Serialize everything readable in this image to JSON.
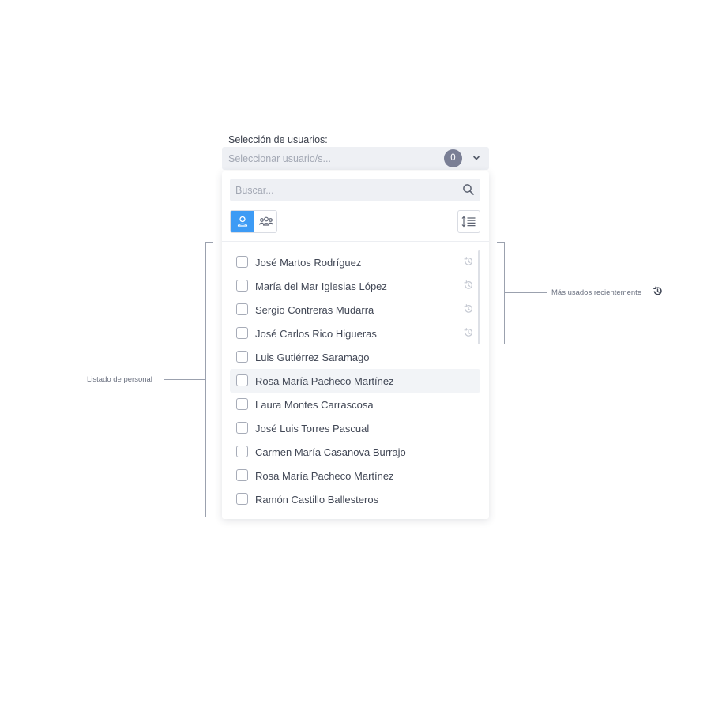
{
  "selector": {
    "label": "Selección de usuarios:",
    "placeholder": "Seleccionar usuario/s...",
    "selected_count": "0"
  },
  "dropdown": {
    "search_placeholder": "Buscar...",
    "active_tab": "users",
    "items": [
      {
        "label": "José Martos Rodríguez",
        "recent": true,
        "checked": false
      },
      {
        "label": "María del Mar Iglesias López",
        "recent": true,
        "checked": false
      },
      {
        "label": "Sergio Contreras Mudarra",
        "recent": true,
        "checked": false
      },
      {
        "label": "José Carlos Rico Higueras",
        "recent": true,
        "checked": false
      },
      {
        "label": "Luis Gutiérrez Saramago",
        "recent": false,
        "checked": false
      },
      {
        "label": "Rosa María Pacheco Martínez",
        "recent": false,
        "checked": false
      },
      {
        "label": "Laura Montes Carrascosa",
        "recent": false,
        "checked": false
      },
      {
        "label": "José Luis Torres Pascual",
        "recent": false,
        "checked": false
      },
      {
        "label": "Carmen María Casanova Burrajo",
        "recent": false,
        "checked": false
      },
      {
        "label": "Rosa María Pacheco Martínez",
        "recent": false,
        "checked": false
      },
      {
        "label": "Ramón Castillo Ballesteros",
        "recent": false,
        "checked": false
      }
    ]
  },
  "annotations": {
    "left": "Listado de personal",
    "right": "Más usados recientemente"
  },
  "colors": {
    "accent": "#3d9bf5",
    "badge": "#7a7f95",
    "field_bg": "#eef0f4",
    "annotation_line": "#9ba1ae"
  }
}
